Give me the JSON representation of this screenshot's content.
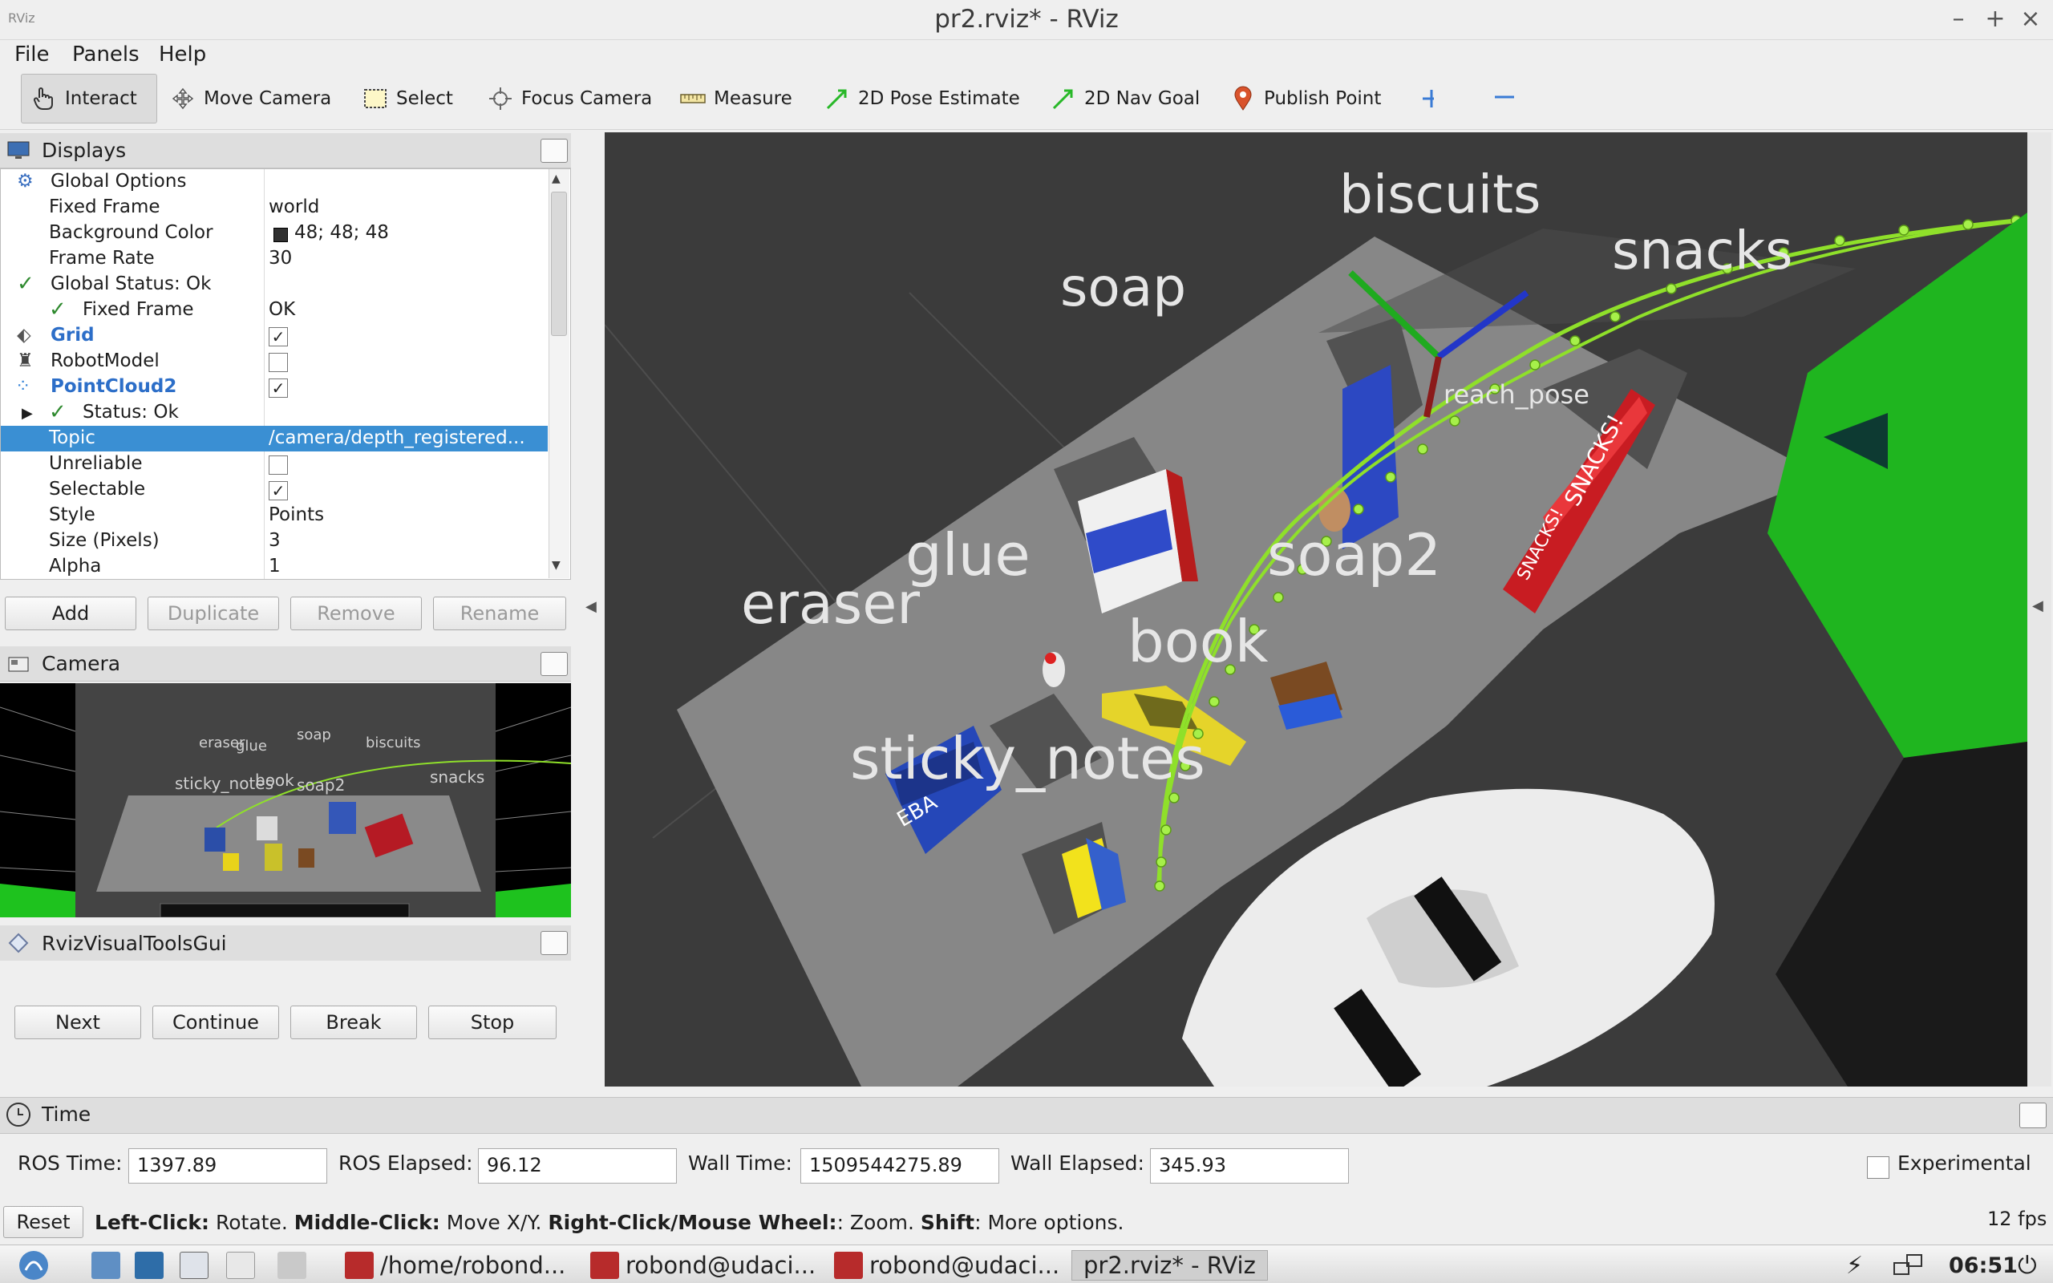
{
  "window": {
    "title": "pr2.rviz* - RViz",
    "app_icon_text": "RViz"
  },
  "menu": [
    "File",
    "Panels",
    "Help"
  ],
  "toolbar": {
    "interact": "Interact",
    "move_camera": "Move Camera",
    "select": "Select",
    "focus_camera": "Focus Camera",
    "measure": "Measure",
    "pose_estimate": "2D Pose Estimate",
    "nav_goal": "2D Nav Goal",
    "publish_point": "Publish Point"
  },
  "displays": {
    "title": "Displays",
    "rows": [
      {
        "key": "Global Options",
        "value": ""
      },
      {
        "key": "Fixed Frame",
        "value": "world"
      },
      {
        "key": "Background Color",
        "value": "48; 48; 48"
      },
      {
        "key": "Frame Rate",
        "value": "30"
      },
      {
        "key": "Global Status: Ok",
        "value": ""
      },
      {
        "key": "Fixed Frame",
        "value": "OK"
      },
      {
        "key": "Grid",
        "value": ""
      },
      {
        "key": "RobotModel",
        "value": ""
      },
      {
        "key": "PointCloud2",
        "value": ""
      },
      {
        "key": "Status: Ok",
        "value": ""
      },
      {
        "key": "Topic",
        "value": "/camera/depth_registered..."
      },
      {
        "key": "Unreliable",
        "value": ""
      },
      {
        "key": "Selectable",
        "value": ""
      },
      {
        "key": "Style",
        "value": "Points"
      },
      {
        "key": "Size (Pixels)",
        "value": "3"
      },
      {
        "key": "Alpha",
        "value": "1"
      }
    ],
    "buttons": {
      "add": "Add",
      "duplicate": "Duplicate",
      "remove": "Remove",
      "rename": "Rename"
    }
  },
  "camera": {
    "title": "Camera",
    "labels": [
      "eraser",
      "glue",
      "soap",
      "biscuits",
      "sticky_notes",
      "book",
      "soap2",
      "snacks"
    ]
  },
  "visual_tools": {
    "title": "RvizVisualToolsGui",
    "buttons": {
      "next": "Next",
      "continue": "Continue",
      "break": "Break",
      "stop": "Stop"
    }
  },
  "scene": {
    "labels": {
      "biscuits": "biscuits",
      "snacks": "snacks",
      "soap": "soap",
      "glue": "glue",
      "soap2": "soap2",
      "eraser": "eraser",
      "book": "book",
      "sticky_notes": "sticky_notes",
      "reach_pose": "reach_pose"
    },
    "package_texts": [
      "SNACKS!",
      "SNACKS!",
      "EBA"
    ]
  },
  "time": {
    "title": "Time",
    "ros_time_label": "ROS Time:",
    "ros_time": "1397.89",
    "ros_elapsed_label": "ROS Elapsed:",
    "ros_elapsed": "96.12",
    "wall_time_label": "Wall Time:",
    "wall_time": "1509544275.89",
    "wall_elapsed_label": "Wall Elapsed:",
    "wall_elapsed": "345.93",
    "experimental": "Experimental"
  },
  "status": {
    "reset": "Reset",
    "hint_1b": "Left-Click:",
    "hint_1": " Rotate. ",
    "hint_2b": "Middle-Click:",
    "hint_2": " Move X/Y. ",
    "hint_3b": "Right-Click/Mouse Wheel:",
    "hint_3": ": Zoom. ",
    "hint_4b": "Shift",
    "hint_4": ": More options.",
    "fps": "12 fps"
  },
  "taskbar": {
    "tasks": [
      "/home/robond...",
      "robond@udaci...",
      "robond@udaci...",
      "pr2.rviz* - RViz"
    ],
    "clock": "06:51"
  },
  "colors": {
    "selection": "#3a8fd3",
    "path": "#8fe02a",
    "background": "#303030"
  }
}
